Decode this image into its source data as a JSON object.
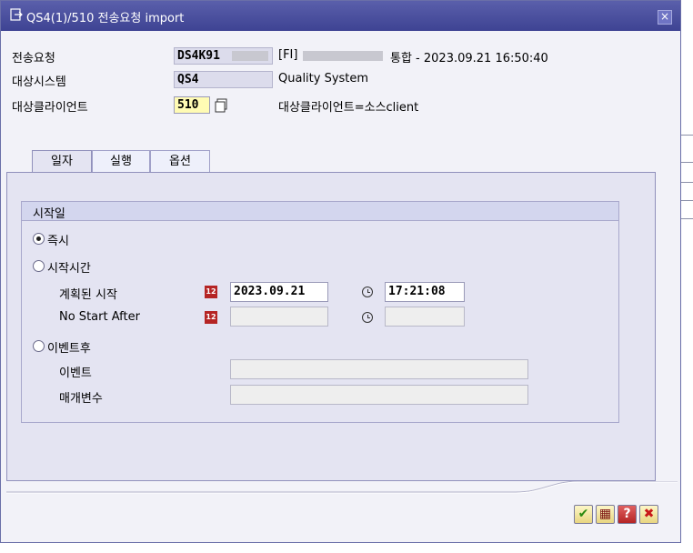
{
  "window": {
    "title": "QS4(1)/510 전송요청 import",
    "close_label": "×"
  },
  "fields": {
    "request": {
      "label": "전송요청",
      "value": "DS4K91",
      "description": "[FI]",
      "suffix": "통합 - 2023.09.21  16:50:40"
    },
    "target_system": {
      "label": "대상시스템",
      "value": "QS4",
      "description": "Quality System"
    },
    "target_client": {
      "label": "대상클라이언트",
      "value": "510",
      "description": "대상클라이언트=소스client"
    }
  },
  "tabs": [
    {
      "label": "일자",
      "active": true
    },
    {
      "label": "실행",
      "active": false
    },
    {
      "label": "옵션",
      "active": false
    }
  ],
  "start_group": {
    "title": "시작일",
    "options": {
      "immediate": {
        "label": "즉시",
        "selected": true
      },
      "start_time": {
        "label": "시작시간",
        "selected": false
      },
      "after_event": {
        "label": "이벤트후",
        "selected": false
      }
    },
    "planned_start": {
      "label": "계획된 시작",
      "date": "2023.09.21",
      "time": "17:21:08"
    },
    "no_start_after": {
      "label": "No Start After",
      "date": "",
      "time": ""
    },
    "event": {
      "label": "이벤트",
      "value": ""
    },
    "parameter": {
      "label": "매개변수",
      "value": ""
    }
  },
  "calendar_icon_text": "12",
  "buttons": {
    "ok": "✔",
    "schedule": "▦",
    "help": "?",
    "cancel": "✖"
  },
  "colors": {
    "title_bar": "#3e4393",
    "tab_line": "#5a5fab",
    "calendar": "#b52424"
  }
}
